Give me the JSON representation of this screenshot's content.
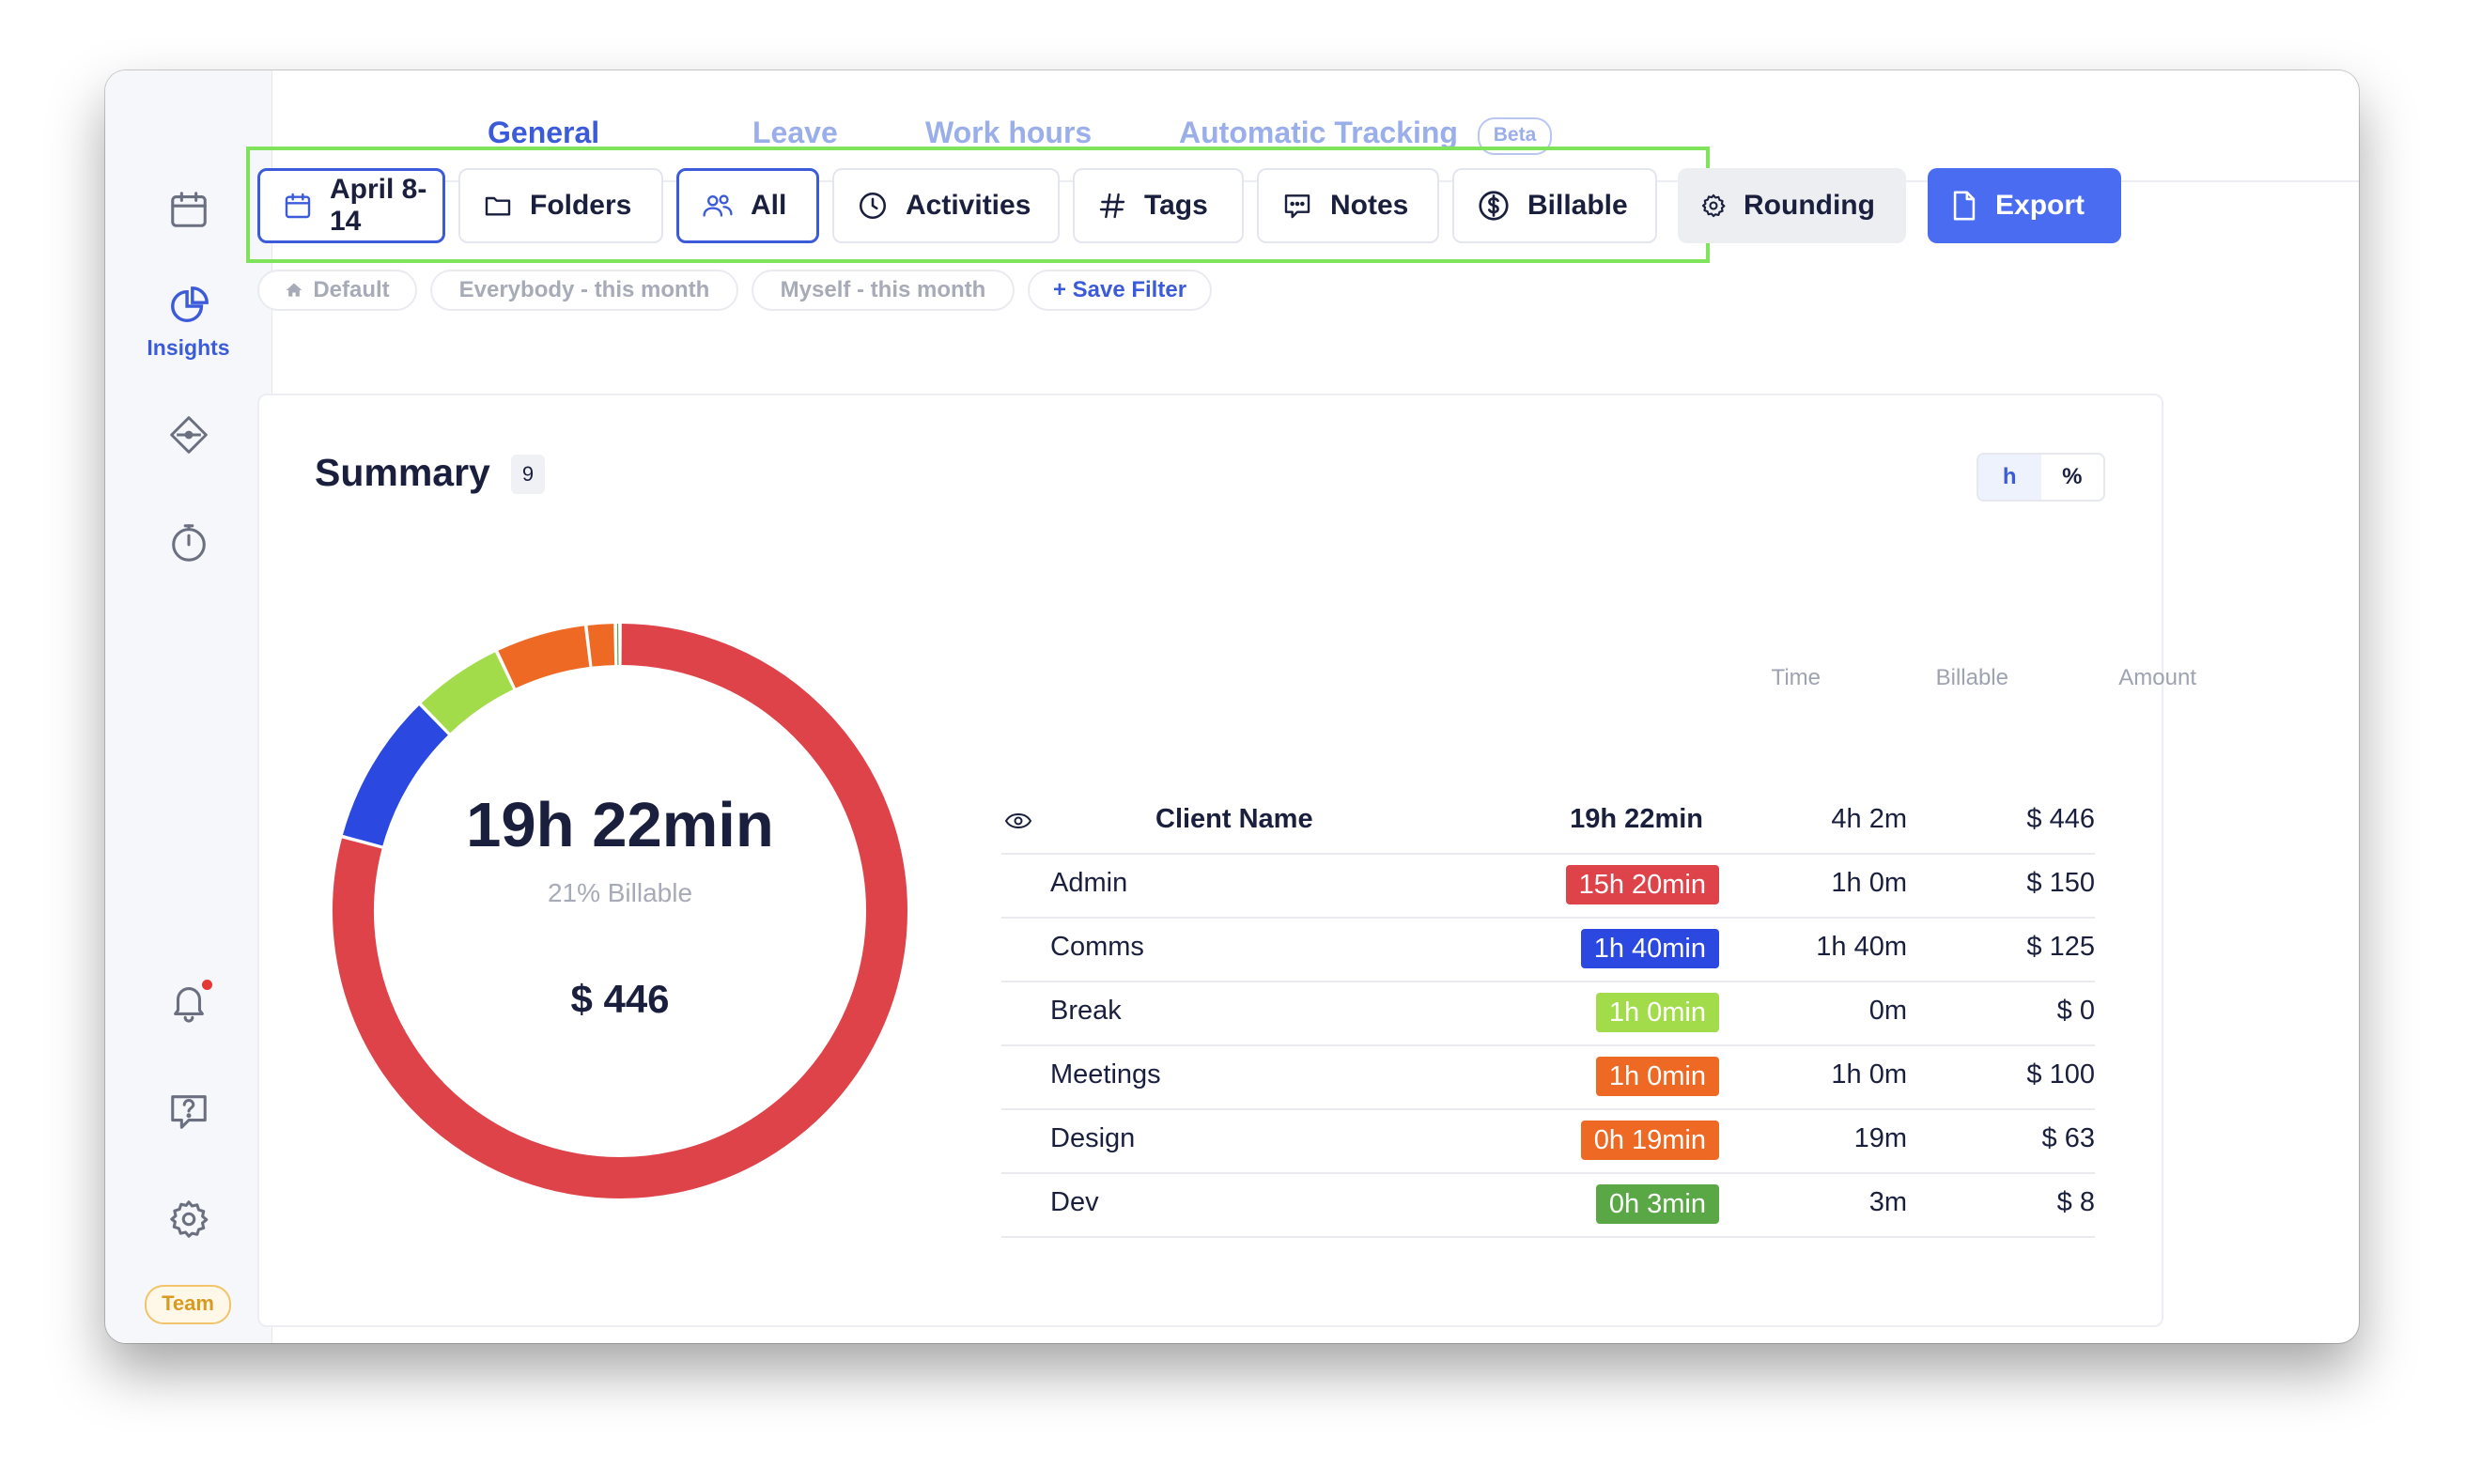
{
  "window": {
    "traffic_colors": [
      "#ff5f57",
      "#febc2e",
      "#28c840"
    ]
  },
  "sidebar": {
    "items": [
      {
        "icon": "calendar-icon",
        "label": ""
      },
      {
        "icon": "pie-chart-icon",
        "label": "Insights",
        "active": true
      },
      {
        "icon": "tag-diamond-icon",
        "label": ""
      },
      {
        "icon": "timer-icon",
        "label": ""
      },
      {
        "icon": "bell-icon",
        "label": ""
      },
      {
        "icon": "help-chat-icon",
        "label": ""
      },
      {
        "icon": "gear-icon",
        "label": ""
      }
    ],
    "team_badge": "Team"
  },
  "tabs": {
    "general": "General",
    "leave": "Leave",
    "work_hours": "Work hours",
    "automatic_tracking": "Automatic Tracking",
    "beta": "Beta"
  },
  "filters": {
    "date": "April 8-14",
    "folders": "Folders",
    "people": "All",
    "activities": "Activities",
    "tags": "Tags",
    "notes": "Notes",
    "billable": "Billable",
    "rounding": "Rounding",
    "export": "Export"
  },
  "saved_filters": {
    "default": "Default",
    "everybody": "Everybody - this month",
    "myself": "Myself - this month",
    "save": "+ Save Filter"
  },
  "summary": {
    "title": "Summary",
    "count": "9",
    "toggle_h": "h",
    "toggle_pct": "%",
    "total_time": "19h 22min",
    "billable_pct": "21% Billable",
    "total_amount": "$ 446"
  },
  "table": {
    "headers": {
      "time": "Time",
      "billable": "Billable",
      "amount": "Amount"
    },
    "group": {
      "name": "Client Name",
      "time": "19h 22min",
      "billable": "4h 2m",
      "amount": "$ 446"
    },
    "rows": [
      {
        "name": "Admin",
        "time": "15h 20min",
        "billable": "1h 0m",
        "amount": "$ 150",
        "color": "#de4349"
      },
      {
        "name": "Comms",
        "time": "1h 40min",
        "billable": "1h 40m",
        "amount": "$ 125",
        "color": "#2b48e0"
      },
      {
        "name": "Break",
        "time": "1h 0min",
        "billable": "0m",
        "amount": "$ 0",
        "color": "#a3dc4b"
      },
      {
        "name": "Meetings",
        "time": "1h 0min",
        "billable": "1h 0m",
        "amount": "$ 100",
        "color": "#ee6a24"
      },
      {
        "name": "Design",
        "time": "0h 19min",
        "billable": "19m",
        "amount": "$ 63",
        "color": "#ee6a24"
      },
      {
        "name": "Dev",
        "time": "0h 3min",
        "billable": "3m",
        "amount": "$ 8",
        "color": "#5aa845"
      }
    ]
  },
  "chart_data": {
    "type": "pie",
    "categories": [
      "Admin",
      "Comms",
      "Break",
      "Meetings",
      "Design",
      "Dev"
    ],
    "values": [
      920,
      100,
      60,
      60,
      19,
      3
    ],
    "colors": [
      "#de4349",
      "#2b48e0",
      "#a3dc4b",
      "#ee6a24",
      "#ee6a24",
      "#5aa845"
    ]
  }
}
